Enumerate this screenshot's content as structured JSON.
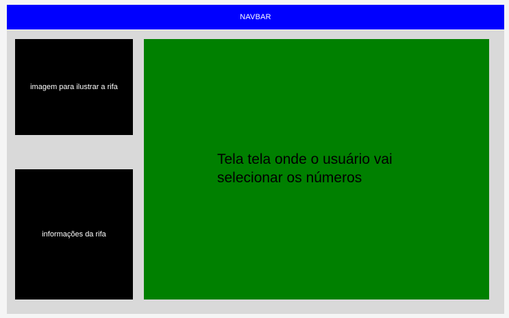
{
  "navbar": {
    "label": "NAVBAR"
  },
  "sidebar": {
    "image_panel_label": "imagem para ilustrar a rifa",
    "info_panel_label": "informações da rifa"
  },
  "main": {
    "text": "Tela tela onde o usuário vai selecionar os números"
  },
  "colors": {
    "navbar": "#0000ff",
    "content_background": "#d9d9d9",
    "panels": "#000000",
    "main_panel": "#008000"
  }
}
